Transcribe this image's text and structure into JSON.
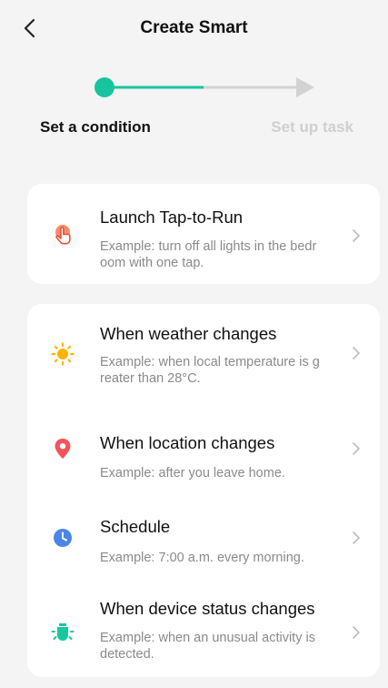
{
  "header": {
    "title": "Create Smart"
  },
  "steps": {
    "current": "Set a condition",
    "next": "Set up task"
  },
  "colors": {
    "accent": "#18c49d",
    "inactive": "#d2d2d2"
  },
  "cards": [
    {
      "items": [
        {
          "icon": "tap-hand-icon",
          "title": "Launch Tap-to-Run",
          "desc": "Example: turn off all lights in the bedr oom with one tap."
        }
      ]
    },
    {
      "items": [
        {
          "icon": "sun-icon",
          "title": "When weather changes",
          "desc": "Example: when local temperature is g reater than 28°C."
        },
        {
          "icon": "location-pin-icon",
          "title": "When location changes",
          "desc": "Example: after you leave home."
        },
        {
          "icon": "clock-icon",
          "title": "Schedule",
          "desc": "Example: 7:00 a.m. every morning."
        },
        {
          "icon": "device-status-icon",
          "title": "When device status changes",
          "desc": "Example: when an unusual activity is detected."
        }
      ]
    }
  ]
}
